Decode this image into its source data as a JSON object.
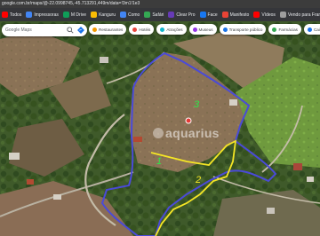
{
  "browser": {
    "url": "google.com.br/maps/@-22.0998745,-45.713291,449m/data=!3m1!1e3"
  },
  "bookmarks": [
    {
      "label": "Todos",
      "icon": "youtube-icon",
      "color": "#ff0000"
    },
    {
      "label": "Impressoras",
      "icon": "printer-icon",
      "color": "#4285f4"
    },
    {
      "label": "M Drive",
      "icon": "drive-icon",
      "color": "#0f9d58"
    },
    {
      "label": "Kanguru",
      "icon": "app-icon",
      "color": "#fbbc04"
    },
    {
      "label": "Como",
      "icon": "doc-icon",
      "color": "#4285f4"
    },
    {
      "label": "Safári",
      "icon": "bookmark-icon",
      "color": "#34a853"
    },
    {
      "label": "Clear Pro",
      "icon": "app-icon",
      "color": "#673ab7"
    },
    {
      "label": "Face",
      "icon": "facebook-icon",
      "color": "#1877f2"
    },
    {
      "label": "Manifesto",
      "icon": "doc-icon",
      "color": "#ea4335"
    },
    {
      "label": "Vídeos",
      "icon": "video-icon",
      "color": "#ff0000"
    },
    {
      "label": "Vendo para Franco",
      "icon": "app-icon",
      "color": "#9e9e9e"
    }
  ],
  "map": {
    "search_placeholder": "Google Maps",
    "categories": [
      {
        "label": "Restaurantes",
        "color": "#f29900"
      },
      {
        "label": "Hotéis",
        "color": "#e8453c"
      },
      {
        "label": "Atrações",
        "color": "#12b5cb"
      },
      {
        "label": "Museus",
        "color": "#9334e6"
      },
      {
        "label": "Transporte público",
        "color": "#1a73e8"
      },
      {
        "label": "Farmácias",
        "color": "#34a853"
      },
      {
        "label": "Caixas",
        "color": "#1a73e8"
      }
    ],
    "plot_labels": {
      "one": "1",
      "two": "2",
      "three": "3"
    },
    "watermark": "aquarius"
  },
  "colors": {
    "boundary_blue": "#4a4ad8",
    "boundary_yellow": "#f5e625",
    "label_green": "#2ee84a",
    "label_yellow": "#f5e625"
  }
}
